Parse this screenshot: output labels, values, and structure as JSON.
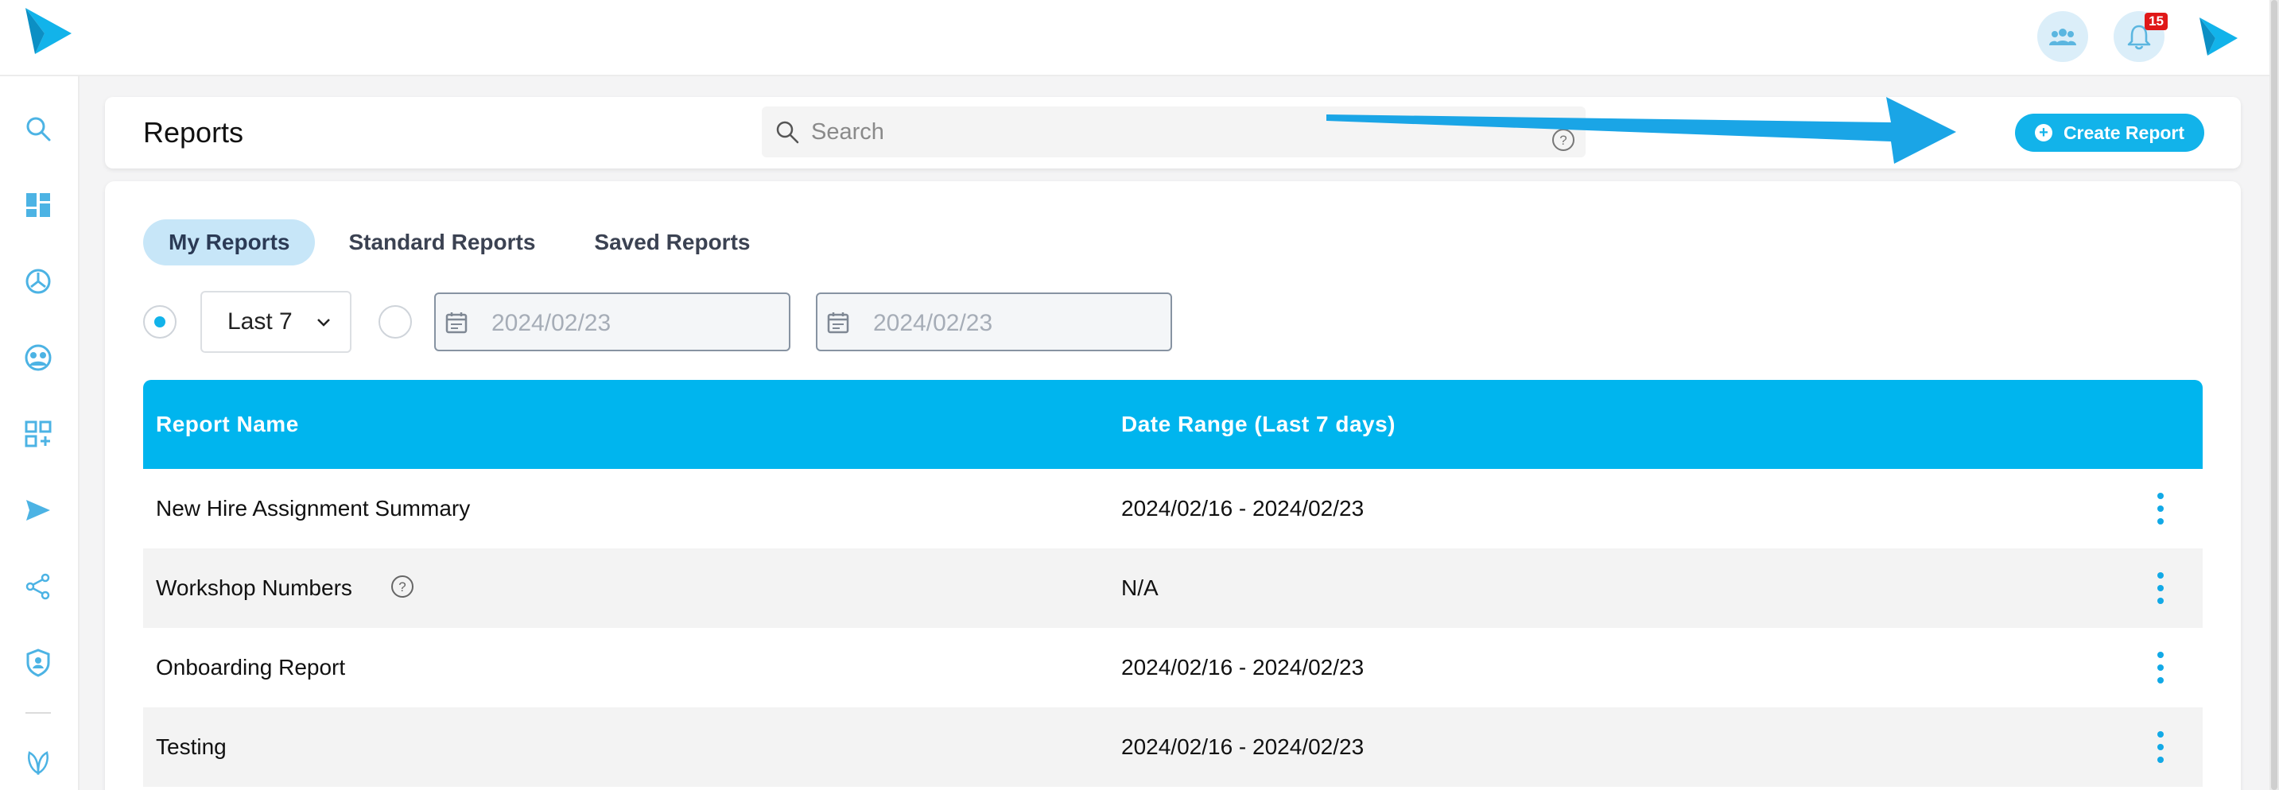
{
  "header": {
    "title": "Reports",
    "search_placeholder": "Search",
    "create_label": "Create Report",
    "notification_count": "15"
  },
  "tabs": [
    {
      "label": "My Reports",
      "active": true
    },
    {
      "label": "Standard Reports",
      "active": false
    },
    {
      "label": "Saved Reports",
      "active": false
    }
  ],
  "filters": {
    "preset_value": "Last 7",
    "start_date": "2024/02/23",
    "end_date": "2024/02/23"
  },
  "table": {
    "headers": [
      "Report Name",
      "Date Range (Last 7 days)"
    ],
    "rows": [
      {
        "name": "New Hire Assignment Summary",
        "range": "2024/02/16 - 2024/02/23"
      },
      {
        "name": "Workshop Numbers",
        "range": "N/A"
      },
      {
        "name": "Onboarding Report",
        "range": "2024/02/16 - 2024/02/23"
      },
      {
        "name": "Testing",
        "range": "2024/02/16 - 2024/02/23"
      }
    ]
  },
  "sidebar_icons": [
    "search-icon",
    "dashboard-icon",
    "dial-icon",
    "people-icon",
    "apps-add-icon",
    "send-icon",
    "share-icon",
    "shield-user-icon",
    "leaf-icon"
  ],
  "colors": {
    "accent": "#00b5ee",
    "button": "#12b3ea",
    "tab_active_bg": "#c7e6f8",
    "badge": "#e01818"
  }
}
